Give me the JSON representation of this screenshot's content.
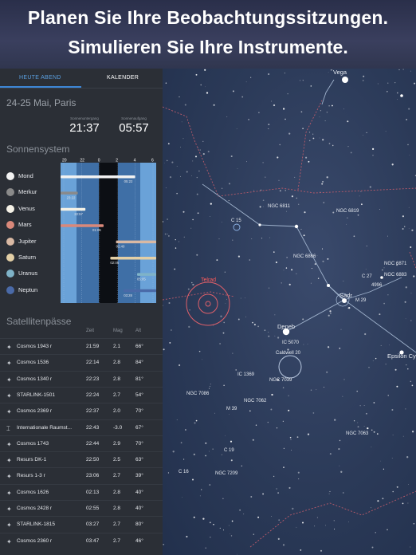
{
  "banner": {
    "line1": "Planen Sie Ihre Beobachtungssitzungen.",
    "line2": "Simulieren Sie Ihre Instrumente."
  },
  "tabs": {
    "tonight": "HEUTE ABEND",
    "calendar": "KALENDER"
  },
  "date_title": "24-25 Mai, Paris",
  "sun": {
    "sunset_caption": "Sonnenuntergang",
    "sunset_time": "21:37",
    "sunrise_caption": "Sonnenaufgang",
    "sunrise_time": "05:57"
  },
  "solar_title": "Sonnensystem",
  "hours": [
    "20",
    "22",
    "0",
    "2",
    "4",
    "6"
  ],
  "planets": [
    {
      "name": "Mond",
      "color": "#f2f2f2",
      "start": 0.0,
      "end": 0.78,
      "label": "05:22"
    },
    {
      "name": "Merkur",
      "color": "#8a8a8a",
      "start": 0.0,
      "end": 0.18,
      "label": "23:22"
    },
    {
      "name": "Venus",
      "color": "#f4f1e6",
      "start": 0.0,
      "end": 0.26,
      "label": "22:57"
    },
    {
      "name": "Mars",
      "color": "#d9887a",
      "start": 0.0,
      "end": 0.45,
      "label": "01:06"
    },
    {
      "name": "Jupiter",
      "color": "#d9b9a4",
      "start": 0.58,
      "end": 1.0,
      "label": "02:40"
    },
    {
      "name": "Saturn",
      "color": "#e3cfa6",
      "start": 0.52,
      "end": 1.0,
      "label": "02:05"
    },
    {
      "name": "Uranus",
      "color": "#7fb3c8",
      "start": 0.8,
      "end": 1.0,
      "label": "05:05"
    },
    {
      "name": "Neptun",
      "color": "#4a6aa8",
      "start": 0.66,
      "end": 1.0,
      "label": "03:28"
    }
  ],
  "sat_title": "Satellitenpässe",
  "sat_headers": {
    "time": "Zeit",
    "mag": "Mag",
    "alt": "Alt"
  },
  "satellites": [
    {
      "name": "Cosmos 1943 r",
      "time": "21:59",
      "mag": "2.1",
      "alt": "66°",
      "icon": "satellite-icon"
    },
    {
      "name": "Cosmos 1536",
      "time": "22:14",
      "mag": "2.8",
      "alt": "84°",
      "icon": "satellite-icon"
    },
    {
      "name": "Cosmos 1340 r",
      "time": "22:23",
      "mag": "2.8",
      "alt": "81°",
      "icon": "satellite-icon"
    },
    {
      "name": "STARLINK-1501",
      "time": "22:24",
      "mag": "2.7",
      "alt": "54°",
      "icon": "satellite-icon"
    },
    {
      "name": "Cosmos 2369 r",
      "time": "22:37",
      "mag": "2.0",
      "alt": "70°",
      "icon": "satellite-icon"
    },
    {
      "name": "Internationale Raumst...",
      "time": "22:43",
      "mag": "-3.0",
      "alt": "67°",
      "icon": "space-station-icon"
    },
    {
      "name": "Cosmos 1743",
      "time": "22:44",
      "mag": "2.9",
      "alt": "70°",
      "icon": "satellite-icon"
    },
    {
      "name": "Resurs DK-1",
      "time": "22:50",
      "mag": "2.5",
      "alt": "63°",
      "icon": "satellite-icon"
    },
    {
      "name": "Resurs 1-3 r",
      "time": "23:06",
      "mag": "2.7",
      "alt": "39°",
      "icon": "satellite-icon"
    },
    {
      "name": "Cosmos 1626",
      "time": "02:13",
      "mag": "2.8",
      "alt": "40°",
      "icon": "satellite-icon"
    },
    {
      "name": "Cosmos 2428 r",
      "time": "02:55",
      "mag": "2.8",
      "alt": "40°",
      "icon": "satellite-icon"
    },
    {
      "name": "STARLINK-1815",
      "time": "03:27",
      "mag": "2.7",
      "alt": "80°",
      "icon": "satellite-icon"
    },
    {
      "name": "Cosmos 2360 r",
      "time": "03:47",
      "mag": "2.7",
      "alt": "46°",
      "icon": "satellite-icon"
    }
  ],
  "sky_labels": [
    "Vega",
    "NGC 6811",
    "NGC 6819",
    "C 15",
    "NGC 6866",
    "NGC 6871",
    "NGC 6883",
    "C 27",
    "4996",
    "Sadr",
    "M 29",
    "Telrad",
    "Deneb",
    "IC 5070",
    "Caldwell 20",
    "IC 1369",
    "NGC 7039",
    "NGC 7086",
    "NGC 7062",
    "M 39",
    "Epsilon Cy",
    "NGC 7063",
    "C 19",
    "C 16",
    "NGC 7209"
  ]
}
